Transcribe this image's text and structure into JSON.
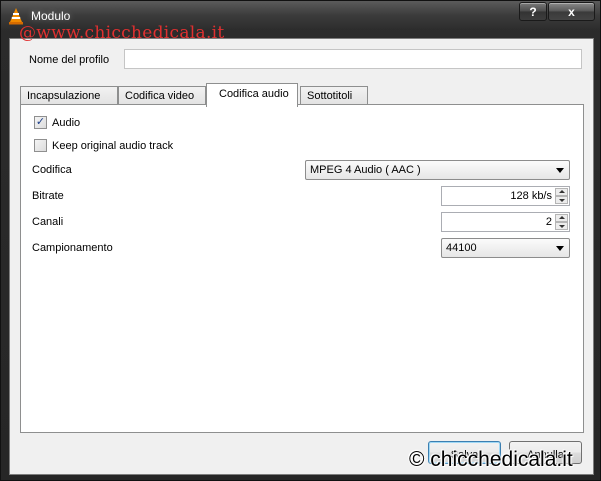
{
  "window": {
    "title": "Modulo",
    "help_label": "?",
    "close_label": "x"
  },
  "watermarks": {
    "top": "@www.chicchedicala.it",
    "bottom": "© chicchedicala.it"
  },
  "profile": {
    "label": "Nome del profilo",
    "value": ""
  },
  "tabs": [
    {
      "label": "Incapsulazione"
    },
    {
      "label": "Codifica video"
    },
    {
      "label": "Codifica audio",
      "active": true
    },
    {
      "label": "Sottotitoli"
    }
  ],
  "audio_panel": {
    "audio_checkbox": {
      "label": "Audio",
      "checked": true,
      "mark": "✓"
    },
    "keep_original": {
      "label": "Keep original audio track",
      "checked": false
    },
    "codec": {
      "label": "Codifica",
      "value": "MPEG 4 Audio ( AAC )"
    },
    "bitrate": {
      "label": "Bitrate",
      "value": "128 kb/s"
    },
    "channels": {
      "label": "Canali",
      "value": "2"
    },
    "samplerate": {
      "label": "Campionamento",
      "value": "44100"
    }
  },
  "buttons": {
    "save": "Salva",
    "cancel": "Annulla"
  }
}
